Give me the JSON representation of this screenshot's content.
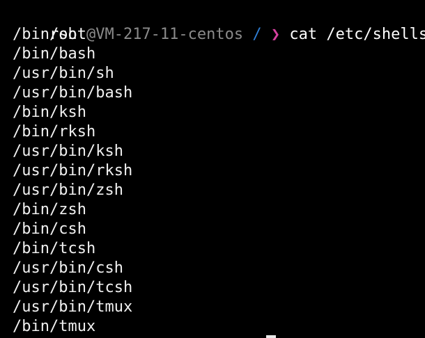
{
  "prompt": {
    "user": "root",
    "host": "@VM-217-11-centos",
    "dir": "/",
    "arrow": "❯",
    "command": "cat /etc/shells"
  },
  "output": [
    "/bin/sh",
    "/bin/bash",
    "/usr/bin/sh",
    "/usr/bin/bash",
    "/bin/ksh",
    "/bin/rksh",
    "/usr/bin/ksh",
    "/usr/bin/rksh",
    "/usr/bin/zsh",
    "/bin/zsh",
    "/bin/csh",
    "/bin/tcsh",
    "/usr/bin/csh",
    "/usr/bin/tcsh",
    "/usr/bin/tmux",
    "/bin/tmux"
  ],
  "colors": {
    "background": "#000000",
    "text": "#f0f0f0",
    "host": "#8a8a8a",
    "dir": "#2f7fd6",
    "arrow": "#d6409f"
  }
}
